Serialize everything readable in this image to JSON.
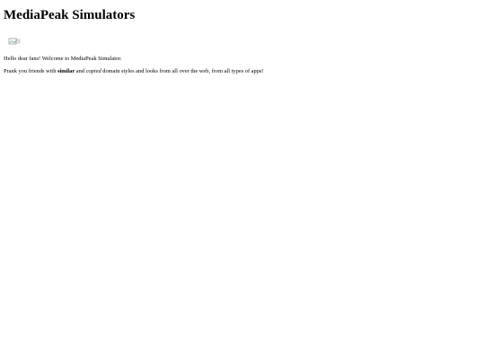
{
  "site": {
    "title": "MediaPeak Simulators",
    "logo_icon": "broken-image-icon"
  },
  "content": {
    "greeting": "Hello dear fans! Welcome to MediaPeak Simulator.",
    "prank": {
      "prefix": "Prank you friends with ",
      "bold": "similar",
      "middle": " and ",
      "italic": "copied",
      "suffix": " domain styles and looks from all over the web, from all types of apps!"
    }
  }
}
